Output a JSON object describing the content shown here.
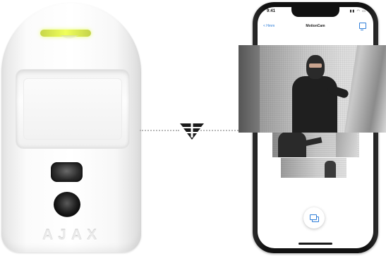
{
  "detector": {
    "brand_logo": "AJAX",
    "led_color": "#e8ff5a"
  },
  "connection": {
    "icon": "jeweller-radio-icon"
  },
  "phone": {
    "status_time": "9:41",
    "status_icons": "signal-wifi-battery",
    "nav_back_label": "< Hmm",
    "nav_title": "MotionCam",
    "nav_action_icon": "export-icon",
    "gallery_icon": "gallery-icon",
    "accent_color": "#2f7ed8"
  }
}
